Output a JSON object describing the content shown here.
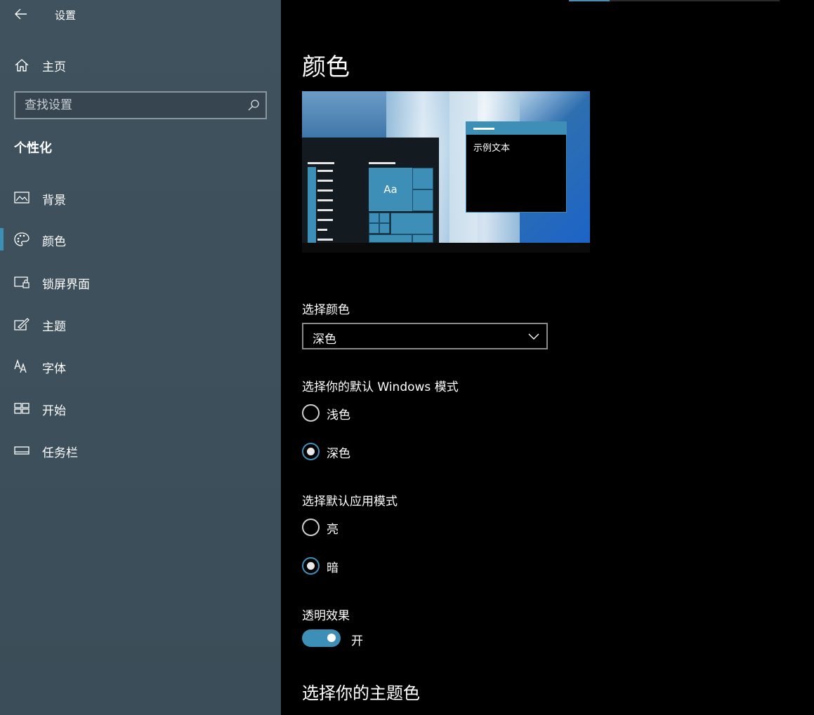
{
  "app": {
    "title": "设置"
  },
  "sidebar": {
    "home_label": "主页",
    "search_placeholder": "查找设置",
    "section_title": "个性化",
    "items": [
      {
        "label": "背景",
        "icon": "picture-icon"
      },
      {
        "label": "颜色",
        "icon": "palette-icon",
        "active": true
      },
      {
        "label": "锁屏界面",
        "icon": "lock-screen-icon"
      },
      {
        "label": "主题",
        "icon": "theme-brush-icon"
      },
      {
        "label": "字体",
        "icon": "font-icon"
      },
      {
        "label": "开始",
        "icon": "start-menu-icon"
      },
      {
        "label": "任务栏",
        "icon": "taskbar-icon"
      }
    ]
  },
  "main": {
    "page_title": "颜色",
    "preview": {
      "sample_text": "示例文本",
      "tile_text": "Aa"
    },
    "choose_color": {
      "label": "选择颜色",
      "value": "深色"
    },
    "windows_mode": {
      "label": "选择你的默认 Windows 模式",
      "options": [
        {
          "label": "浅色",
          "checked": false
        },
        {
          "label": "深色",
          "checked": true
        }
      ]
    },
    "app_mode": {
      "label": "选择默认应用模式",
      "options": [
        {
          "label": "亮",
          "checked": false
        },
        {
          "label": "暗",
          "checked": true
        }
      ]
    },
    "transparency": {
      "label": "透明效果",
      "state_label": "开",
      "on": true
    },
    "accent_heading": "选择你的主题色"
  },
  "colors": {
    "accent": "#3d8fb8",
    "sidebar_bg": "#3d4f5b",
    "main_bg": "#000000"
  }
}
